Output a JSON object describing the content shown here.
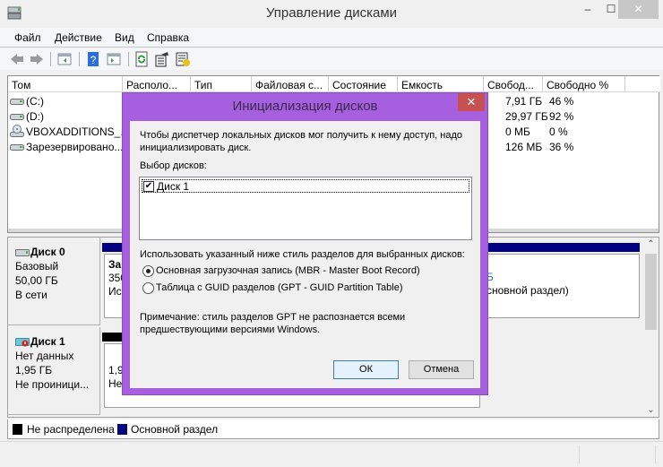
{
  "window": {
    "title": "Управление дисками",
    "controls": {
      "minimize": "‒",
      "maximize": "☐",
      "close": "✕"
    }
  },
  "menu": [
    "Файл",
    "Действие",
    "Вид",
    "Справка"
  ],
  "toolbar": {
    "buttons": [
      "back-icon",
      "forward-icon",
      "show-hide-console-tree-icon",
      "help-icon",
      "show-hide-action-pane-icon",
      "refresh-icon",
      "properties-icon",
      "settings-icon"
    ]
  },
  "volume_table": {
    "columns": [
      "Том",
      "Располо...",
      "Тип",
      "Файловая с...",
      "Состояние",
      "Емкость",
      "Свобод...",
      "Свободно %"
    ],
    "rows": [
      {
        "name": "(C:)",
        "icon": "drive-icon",
        "free": "7,91 ГБ",
        "free_pct": "46 %"
      },
      {
        "name": "(D:)",
        "icon": "drive-icon",
        "free": "29,97 ГБ",
        "free_pct": "92 %"
      },
      {
        "name": "VBOXADDITIONS_...",
        "icon": "cd-drive-icon",
        "free": "0 МБ",
        "free_pct": "0 %"
      },
      {
        "name": "Зарезервировано...",
        "icon": "drive-icon",
        "free": "126 МБ",
        "free_pct": "36 %"
      }
    ]
  },
  "disks": [
    {
      "title": "Диск 0",
      "type": "Базовый",
      "size": "50,00 ГБ",
      "status": "В сети",
      "partition": {
        "line1": "Зар",
        "line2": "350",
        "line3": "Ис",
        "right_line1": "Б",
        "right_line2": "сновной раздел)"
      }
    },
    {
      "title": "Диск 1",
      "type": "Нет данных",
      "size": "1,95 ГБ",
      "status": "Не проиници...",
      "partition": {
        "line1": "1,9",
        "line2": "Не"
      }
    }
  ],
  "legend": [
    {
      "label": "Не распределена",
      "color": "#000000"
    },
    {
      "label": "Основной раздел",
      "color": "#000080"
    }
  ],
  "dialog": {
    "title": "Инициализация дисков",
    "close": "✕",
    "intro_line1": "Чтобы диспетчер локальных дисков мог получить к нему доступ, надо",
    "intro_line2": "инициализировать диск.",
    "select_label": "Выбор дисков:",
    "disk_items": [
      {
        "label": "Диск 1",
        "checked": true
      }
    ],
    "style_label": "Использовать указанный ниже стиль разделов для выбранных дисков:",
    "options": [
      {
        "label": "Основная загрузочная запись (MBR - Master Boot Record)",
        "selected": true
      },
      {
        "label": "Таблица с GUID разделов (GPT - GUID Partition Table)",
        "selected": false
      }
    ],
    "note_line1": "Примечание: стиль разделов GPT не распознается всеми",
    "note_line2": "предшествующими версиями Windows.",
    "ok_label": "ОК",
    "cancel_label": "Отмена"
  },
  "colors": {
    "dialog_frame": "#a65fde",
    "dialog_close": "#c75050",
    "primary_partition": "#000080",
    "unallocated": "#000000"
  }
}
